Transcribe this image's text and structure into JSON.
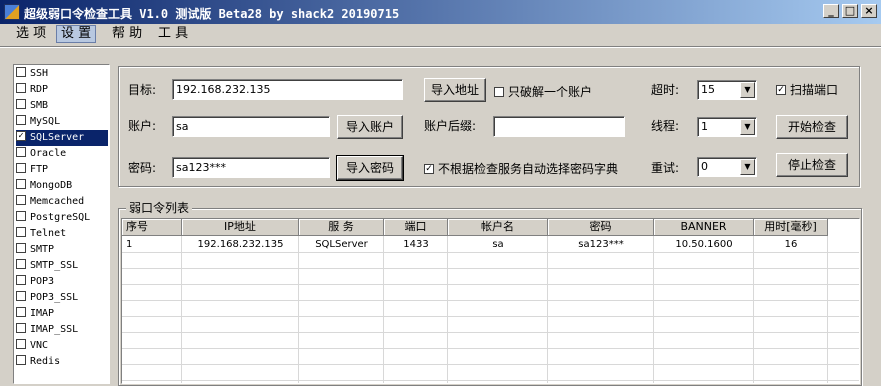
{
  "window": {
    "title": "超级弱口令检查工具 V1.0 测试版 Beta28 by shack2 20190715",
    "buttons": {
      "minimize": "_",
      "maximize": "□",
      "close": "×"
    }
  },
  "menu": [
    "选 项",
    "设 置",
    "帮 助",
    "工 具"
  ],
  "services": [
    {
      "name": "SSH",
      "checked": false
    },
    {
      "name": "RDP",
      "checked": false
    },
    {
      "name": "SMB",
      "checked": false
    },
    {
      "name": "MySQL",
      "checked": false
    },
    {
      "name": "SQLServer",
      "checked": true,
      "selected": true
    },
    {
      "name": "Oracle",
      "checked": false
    },
    {
      "name": "FTP",
      "checked": false
    },
    {
      "name": "MongoDB",
      "checked": false
    },
    {
      "name": "Memcached",
      "checked": false
    },
    {
      "name": "PostgreSQL",
      "checked": false
    },
    {
      "name": "Telnet",
      "checked": false
    },
    {
      "name": "SMTP",
      "checked": false
    },
    {
      "name": "SMTP_SSL",
      "checked": false
    },
    {
      "name": "POP3",
      "checked": false
    },
    {
      "name": "POP3_SSL",
      "checked": false
    },
    {
      "name": "IMAP",
      "checked": false
    },
    {
      "name": "IMAP_SSL",
      "checked": false
    },
    {
      "name": "VNC",
      "checked": false
    },
    {
      "name": "Redis",
      "checked": false
    }
  ],
  "form": {
    "target_label": "目标:",
    "target_value": "192.168.232.135",
    "import_address": "导入地址",
    "crack_one_label": "只破解一个账户",
    "crack_one_checked": false,
    "timeout_label": "超时:",
    "timeout_value": "15",
    "scan_port_label": "扫描端口",
    "scan_port_checked": true,
    "account_label": "账户:",
    "account_value": "sa",
    "import_account": "导入账户",
    "suffix_label": "账户后缀:",
    "suffix_value": "",
    "threads_label": "线程:",
    "threads_value": "1",
    "start_button": "开始检查",
    "password_label": "密码:",
    "password_value": "sa123***",
    "import_password": "导入密码",
    "auto_dict_label": "不根据检查服务自动选择密码字典",
    "auto_dict_checked": true,
    "retry_label": "重试:",
    "retry_value": "0",
    "stop_button": "停止检查"
  },
  "results": {
    "group_title": "弱口令列表",
    "columns": [
      "序号",
      "IP地址",
      "服 务",
      "端口",
      "帐户名",
      "密码",
      "BANNER",
      "用时[毫秒]"
    ],
    "rows": [
      [
        "1",
        "192.168.232.135",
        "SQLServer",
        "1433",
        "sa",
        "sa123***",
        "10.50.1600",
        "16"
      ]
    ]
  },
  "icons": {
    "check_mark": "✓",
    "dropdown_arrow": "▼"
  }
}
